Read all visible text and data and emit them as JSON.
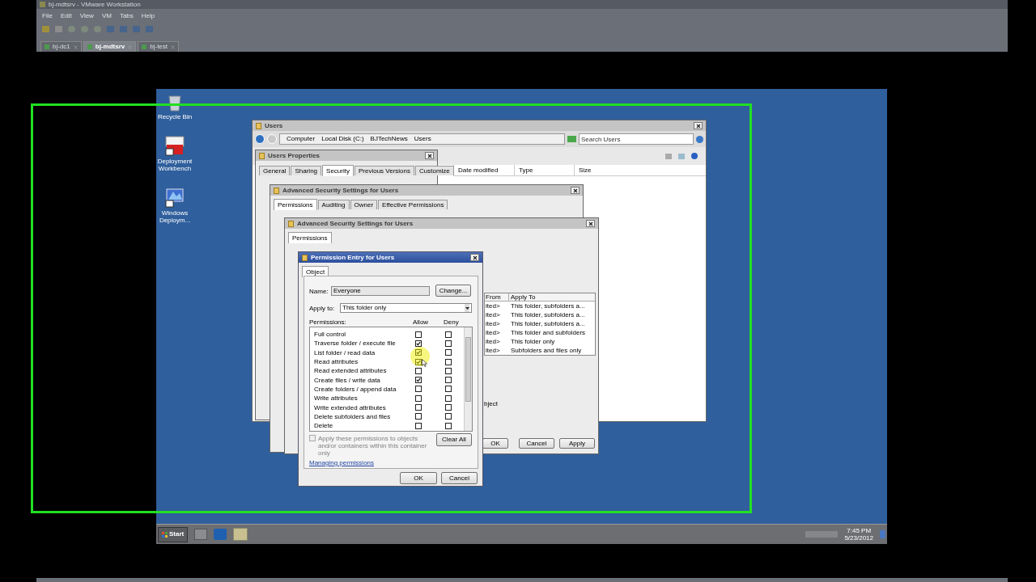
{
  "vmware": {
    "title": "bj-mdtsrv - VMware Workstation",
    "menu": [
      "File",
      "Edit",
      "View",
      "VM",
      "Tabs",
      "Help"
    ],
    "tabs": [
      {
        "label": "bj-dc1",
        "selected": false
      },
      {
        "label": "bj-mdtsrv",
        "selected": true
      },
      {
        "label": "bj-test",
        "selected": false
      }
    ]
  },
  "desktop": {
    "icons": [
      {
        "label": "Recycle Bin",
        "kind": "bin"
      },
      {
        "label": "Deployment Workbench",
        "kind": "toolbox"
      },
      {
        "label": "Windows Deploym...",
        "kind": "deploy"
      }
    ]
  },
  "explorer": {
    "title": "Users",
    "breadcrumb": [
      "Computer",
      "Local Disk (C:)",
      "BJTechNews",
      "Users"
    ],
    "search": {
      "placeholder": "Search Users"
    },
    "columns": [
      "Date modified",
      "Type",
      "Size"
    ]
  },
  "properties": {
    "title": "Users Properties",
    "tabs": [
      {
        "label": "General",
        "selected": false
      },
      {
        "label": "Sharing",
        "selected": false
      },
      {
        "label": "Security",
        "selected": true
      },
      {
        "label": "Previous Versions",
        "selected": false
      },
      {
        "label": "Customize",
        "selected": false
      }
    ]
  },
  "advanced_1": {
    "title": "Advanced Security Settings for Users",
    "tabs": [
      {
        "label": "Permissions",
        "selected": true
      },
      {
        "label": "Auditing",
        "selected": false
      },
      {
        "label": "Owner",
        "selected": false
      },
      {
        "label": "Effective Permissions",
        "selected": false
      }
    ]
  },
  "advanced_2": {
    "title": "Advanced Security Settings for Users",
    "tabs": [
      {
        "label": "Permissions",
        "selected": true
      }
    ],
    "columns": [
      "From",
      "Apply To"
    ],
    "rows": [
      {
        "from": "ited>",
        "apply_to": "This folder, subfolders a..."
      },
      {
        "from": "ited>",
        "apply_to": "This folder, subfolders a..."
      },
      {
        "from": "ited>",
        "apply_to": "This folder, subfolders a..."
      },
      {
        "from": "ited>",
        "apply_to": "This folder and subfolders"
      },
      {
        "from": "ited>",
        "apply_to": "This folder only"
      },
      {
        "from": "ited>",
        "apply_to": "Subfolders and files only"
      }
    ],
    "note": "bject",
    "buttons": [
      "OK",
      "Cancel",
      "Apply"
    ]
  },
  "entry": {
    "title": "Permission Entry for Users",
    "tabs": [
      {
        "label": "Object",
        "selected": true
      }
    ],
    "name_label": "Name:",
    "name": "Everyone",
    "change": "Change...",
    "apply_label": "Apply to:",
    "apply_to": "This folder only",
    "permissions_label": "Permissions:",
    "allow_label": "Allow",
    "deny_label": "Deny",
    "permissions": [
      {
        "name": "Full control",
        "allow": false,
        "deny": false
      },
      {
        "name": "Traverse folder / execute file",
        "allow": true,
        "deny": false
      },
      {
        "name": "List folder / read data",
        "allow": true,
        "deny": false
      },
      {
        "name": "Read attributes",
        "allow": true,
        "deny": false
      },
      {
        "name": "Read extended attributes",
        "allow": false,
        "deny": false
      },
      {
        "name": "Create files / write data",
        "allow": true,
        "deny": false
      },
      {
        "name": "Create folders / append data",
        "allow": false,
        "deny": false
      },
      {
        "name": "Write attributes",
        "allow": false,
        "deny": false
      },
      {
        "name": "Write extended attributes",
        "allow": false,
        "deny": false
      },
      {
        "name": "Delete subfolders and files",
        "allow": false,
        "deny": false
      },
      {
        "name": "Delete",
        "allow": false,
        "deny": false
      }
    ],
    "apply_inherit": {
      "label": "Apply these permissions to objects and/or containers within this container only",
      "checked": false,
      "disabled": true
    },
    "clear_all": "Clear All",
    "link": "Managing permissions",
    "buttons": [
      "OK",
      "Cancel"
    ]
  },
  "taskbar": {
    "start": "Start",
    "time": "7:45 PM",
    "date": "5/23/2012"
  }
}
